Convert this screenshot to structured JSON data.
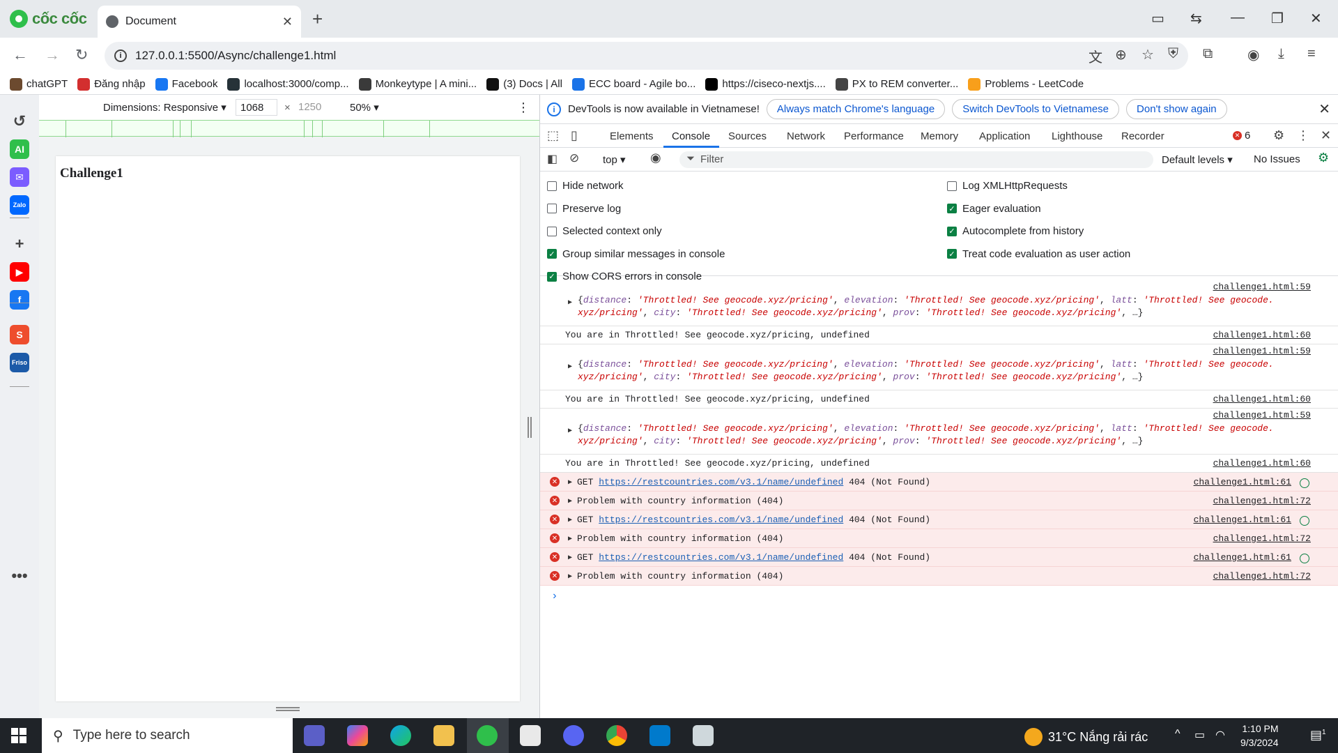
{
  "browser": {
    "brand": "cốc cốc",
    "tab_title": "Document",
    "url": "127.0.0.1:5500/Async/challenge1.html"
  },
  "bookmarks": [
    {
      "label": "chatGPT",
      "color": "#6c4a2f"
    },
    {
      "label": "Đăng nhập",
      "color": "#d32f2f"
    },
    {
      "label": "Facebook",
      "color": "#1877f2"
    },
    {
      "label": "localhost:3000/comp...",
      "color": "#263238"
    },
    {
      "label": "Monkeytype | A mini...",
      "color": "#3a3a3a"
    },
    {
      "label": "(3) Docs | All",
      "color": "#111111"
    },
    {
      "label": "ECC board - Agile bo...",
      "color": "#1a73e8"
    },
    {
      "label": "https://ciseco-nextjs....",
      "color": "#000000"
    },
    {
      "label": "PX to REM converter...",
      "color": "#444444"
    },
    {
      "label": "Problems - LeetCode",
      "color": "#f89f1b"
    }
  ],
  "sidebar_icons": [
    {
      "name": "history-icon",
      "glyph": "↺",
      "color": "#444444"
    },
    {
      "name": "ai-icon",
      "glyph": "AI",
      "color": "#2fbf4b"
    },
    {
      "name": "messenger-icon",
      "glyph": "✉",
      "color": "#7b5cff"
    },
    {
      "name": "zalo-icon",
      "glyph": "Zalo",
      "color": "#0068ff"
    },
    {
      "name": "add-icon",
      "glyph": "+",
      "color": "#444444"
    },
    {
      "name": "youtube-icon",
      "glyph": "▶",
      "color": "#ff0000"
    },
    {
      "name": "facebook-icon",
      "glyph": "f",
      "color": "#1877f2"
    },
    {
      "name": "shopee-icon",
      "glyph": "S",
      "color": "#ee4d2d"
    },
    {
      "name": "friso-icon",
      "glyph": "Friso",
      "color": "#1c5aa8"
    },
    {
      "name": "more-icon",
      "glyph": "•••",
      "color": "#444444"
    }
  ],
  "emulation": {
    "dimensions_label": "Dimensions: Responsive",
    "width": "1068",
    "times": "×",
    "height_placeholder": "1250",
    "zoom": "50%",
    "page_heading": "Challenge1"
  },
  "devtools": {
    "info_text": "DevTools is now available in Vietnamese!",
    "btn_match": "Always match Chrome's language",
    "btn_switch": "Switch DevTools to Vietnamese",
    "btn_dont": "Don't show again",
    "tabs": [
      "Elements",
      "Console",
      "Sources",
      "Network",
      "Performance",
      "Memory",
      "Application",
      "Lighthouse",
      "Recorder"
    ],
    "error_count": "6",
    "context": "top",
    "filter_placeholder": "Filter",
    "levels": "Default levels",
    "issues": "No Issues",
    "settings_left": [
      {
        "label": "Hide network",
        "checked": false
      },
      {
        "label": "Preserve log",
        "checked": false
      },
      {
        "label": "Selected context only",
        "checked": false
      },
      {
        "label": "Group similar messages in console",
        "checked": true
      },
      {
        "label": "Show CORS errors in console",
        "checked": true
      }
    ],
    "settings_right": [
      {
        "label": "Log XMLHttpRequests",
        "checked": false
      },
      {
        "label": "Eager evaluation",
        "checked": true
      },
      {
        "label": "Autocomplete from history",
        "checked": true
      },
      {
        "label": "Treat code evaluation as user action",
        "checked": true
      }
    ],
    "object_line1": [
      [
        "{",
        ""
      ],
      [
        "distance",
        "k"
      ],
      [
        ": ",
        ""
      ],
      [
        "'Throttled! See geocode.xyz/pricing'",
        "s"
      ],
      [
        ", ",
        ""
      ],
      [
        "elevation",
        "k"
      ],
      [
        ": ",
        ""
      ],
      [
        "'Throttled! See geocode.xyz/pricing'",
        "s"
      ],
      [
        ", ",
        ""
      ],
      [
        "latt",
        "k"
      ],
      [
        ": ",
        ""
      ],
      [
        "'Throttled! See geocode.",
        "s"
      ]
    ],
    "object_line2": [
      [
        "xyz/pricing'",
        "s"
      ],
      [
        ", ",
        ""
      ],
      [
        "city",
        "k"
      ],
      [
        ": ",
        ""
      ],
      [
        "'Throttled! See geocode.xyz/pricing'",
        "s"
      ],
      [
        ", ",
        ""
      ],
      [
        "prov",
        "k"
      ],
      [
        ": ",
        ""
      ],
      [
        "'Throttled! See geocode.xyz/pricing'",
        "s"
      ],
      [
        ", …}",
        ""
      ]
    ],
    "log_message": "You are in Throttled! See geocode.xyz/pricing, undefined",
    "src_59": "challenge1.html:59",
    "src_60": "challenge1.html:60",
    "src_61": "challenge1.html:61",
    "src_72": "challenge1.html:72",
    "get_prefix": "GET ",
    "get_url": "https://restcountries.com/v3.1/name/undefined",
    "get_suffix": " 404 (Not Found)",
    "problem_message": "Problem with country information (404)",
    "prompt": "›"
  },
  "taskbar": {
    "search_placeholder": "Type here to search",
    "weather": "31°C  Nắng rải rác",
    "time": "1:10 PM",
    "date": "9/3/2024",
    "notifications": "1"
  }
}
